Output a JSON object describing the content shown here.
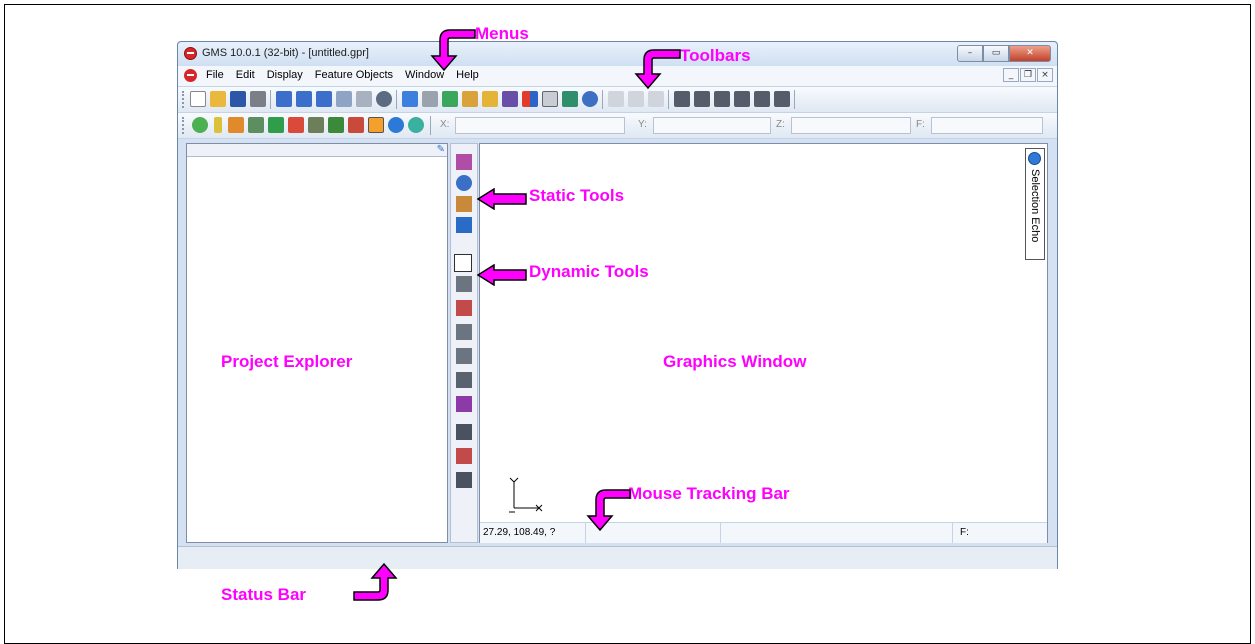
{
  "window": {
    "title": "GMS 10.0.1 (32-bit) - [untitled.gpr]",
    "minimize": "–",
    "maximize": "▭",
    "close": "✕"
  },
  "menu": {
    "items": [
      "File",
      "Edit",
      "Display",
      "Feature Objects",
      "Window",
      "Help"
    ]
  },
  "mdi": {
    "minimize": "_",
    "restore": "❐",
    "close": "×"
  },
  "tracking_fields": {
    "x": "X:",
    "y": "Y:",
    "z": "Z:",
    "f": "F:"
  },
  "selection_echo": {
    "label": "Selection Echo"
  },
  "mouse_tracking": {
    "coords": "27.29, 108.49, ?",
    "f": "F:"
  },
  "callouts": {
    "menus": "Menus",
    "toolbars": "Toolbars",
    "static_tools": "Static Tools",
    "dynamic_tools": "Dynamic Tools",
    "project_explorer": "Project Explorer",
    "graphics_window": "Graphics Window",
    "mouse_tracking_bar": "Mouse Tracking Bar",
    "status_bar": "Status Bar"
  },
  "colors": {
    "callout": "#ff00ff"
  }
}
